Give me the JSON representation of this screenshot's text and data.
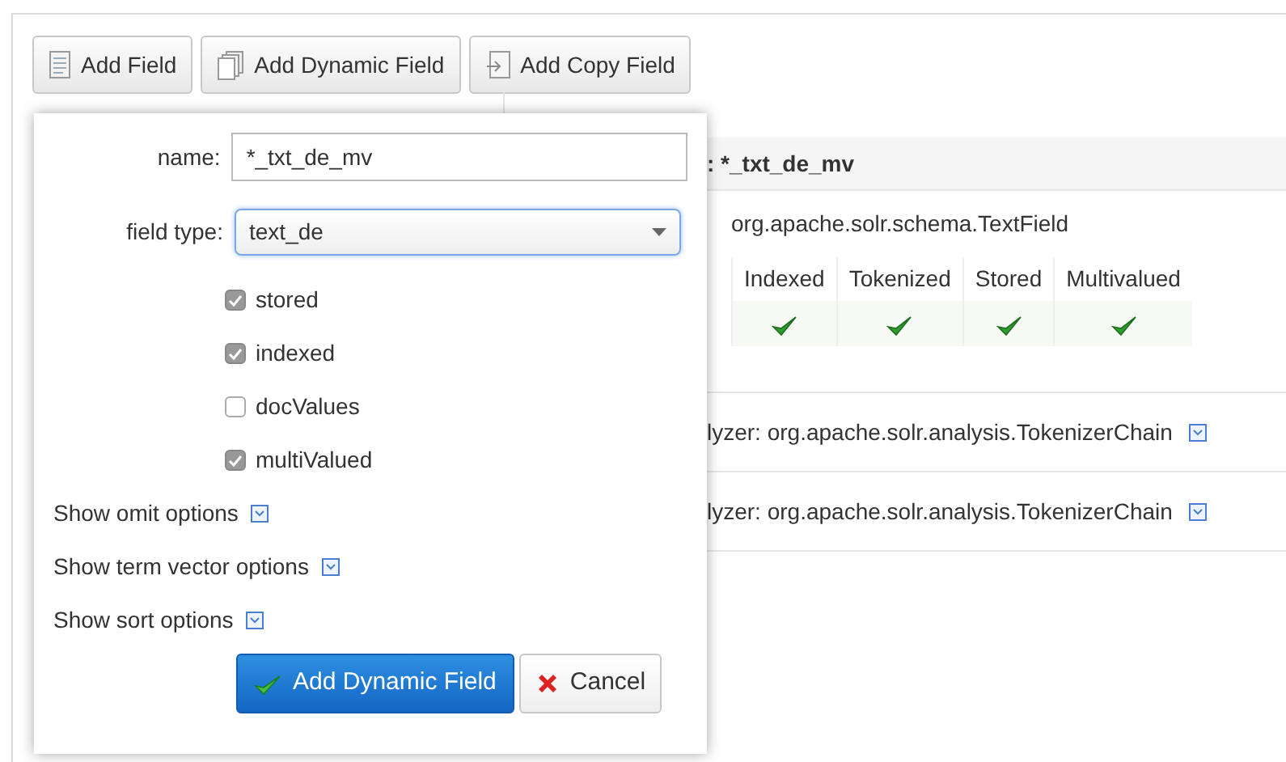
{
  "toolbar": [
    {
      "label": "Add Field",
      "kind": "field"
    },
    {
      "label": "Add Dynamic Field",
      "kind": "dynamic"
    },
    {
      "label": "Add Copy Field",
      "kind": "copy"
    }
  ],
  "details": {
    "title": ": *_txt_de_mv",
    "class_name": "org.apache.solr.schema.TextField",
    "flags": [
      {
        "label": "Indexed",
        "checked": true
      },
      {
        "label": "Tokenized",
        "checked": true
      },
      {
        "label": "Stored",
        "checked": true
      },
      {
        "label": "Multivalued",
        "checked": true
      }
    ],
    "analyzers": [
      "lyzer: org.apache.solr.analysis.TokenizerChain",
      "lyzer: org.apache.solr.analysis.TokenizerChain"
    ]
  },
  "dialog": {
    "name_label": "name:",
    "name_value": "*_txt_de_mv",
    "type_label": "field type:",
    "type_value": "text_de",
    "checkboxes": [
      {
        "label": "stored",
        "checked": true
      },
      {
        "label": "indexed",
        "checked": true
      },
      {
        "label": "docValues",
        "checked": false
      },
      {
        "label": "multiValued",
        "checked": true
      }
    ],
    "toggles": [
      "Show omit options",
      "Show term vector options",
      "Show sort options"
    ],
    "submit": "Add Dynamic Field",
    "cancel": "Cancel"
  }
}
